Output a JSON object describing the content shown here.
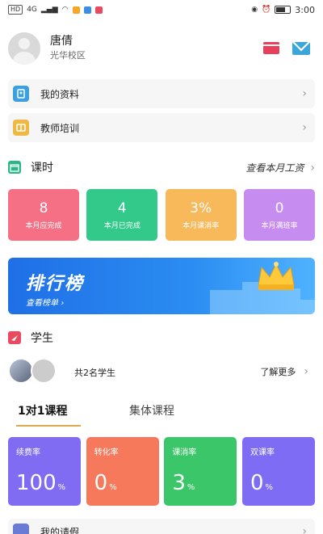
{
  "status_bar": {
    "left_badges": [
      "HD",
      "4G"
    ],
    "time": "3:00"
  },
  "profile": {
    "name": "唐倩",
    "campus": "光华校区"
  },
  "menu": {
    "items": [
      {
        "label": "我的资料",
        "icon": "id-card-icon",
        "color": "#3aa0e0"
      },
      {
        "label": "教师培训",
        "icon": "book-icon",
        "color": "#f0b840"
      }
    ]
  },
  "lessons": {
    "title": "课时",
    "link": "查看本月工资",
    "stats": [
      {
        "value": "8",
        "label": "本月应完成",
        "color": "#f56f85"
      },
      {
        "value": "4",
        "label": "本月已完成",
        "color": "#32c98a"
      },
      {
        "value": "3%",
        "label": "本月课消率",
        "color": "#f7b95a"
      },
      {
        "value": "0",
        "label": "本月满班率",
        "color": "#c78cf0"
      }
    ]
  },
  "banner": {
    "title": "排行榜",
    "subtitle": "查看榜单"
  },
  "students": {
    "title": "学生",
    "count_text": "共2名学生",
    "more": "了解更多"
  },
  "course_tabs": {
    "tabs": [
      {
        "label": "1对1课程",
        "active": true
      },
      {
        "label": "集体课程",
        "active": false
      }
    ]
  },
  "kpis": [
    {
      "label": "续费率",
      "value": "100",
      "unit": "%",
      "color": "#7f6cf3"
    },
    {
      "label": "转化率",
      "value": "0",
      "unit": "%",
      "color": "#f5795a"
    },
    {
      "label": "课消率",
      "value": "3",
      "unit": "%",
      "color": "#3cc66a"
    },
    {
      "label": "双课率",
      "value": "0",
      "unit": "%",
      "color": "#7e6cf5"
    }
  ],
  "leave": {
    "label": "我的请假"
  },
  "colors": {
    "accent_tab_underline": "#e0a84c",
    "banner_blue": "#2b8df2"
  }
}
